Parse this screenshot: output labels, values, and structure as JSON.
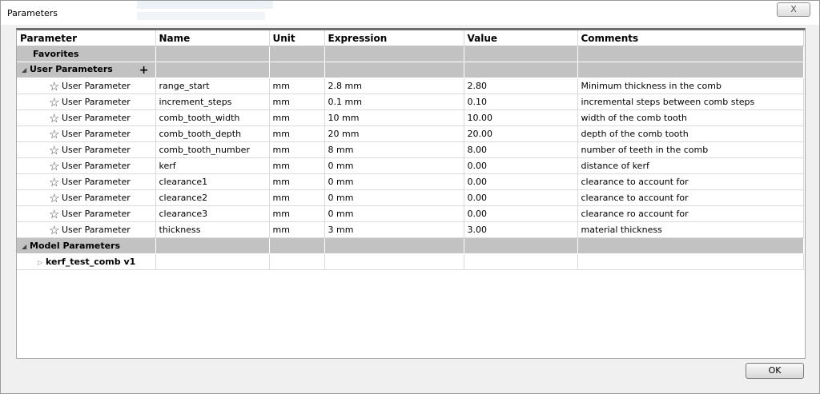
{
  "window": {
    "title": "Parameters",
    "close_label": "X",
    "ok_label": "OK"
  },
  "columns": [
    "Parameter",
    "Name",
    "Unit",
    "Expression",
    "Value",
    "Comments"
  ],
  "sections": {
    "favorites": "Favorites",
    "user_parameters": "User Parameters",
    "model_parameters": "Model Parameters",
    "add_symbol": "+"
  },
  "user_rows": [
    {
      "type": "User Parameter",
      "name": "range_start",
      "unit": "mm",
      "expression": "2.8 mm",
      "value": "2.80",
      "comment": "Minimum thickness in the comb"
    },
    {
      "type": "User Parameter",
      "name": "increment_steps",
      "unit": "mm",
      "expression": "0.1 mm",
      "value": "0.10",
      "comment": "incremental steps between comb steps"
    },
    {
      "type": "User Parameter",
      "name": "comb_tooth_width",
      "unit": "mm",
      "expression": "10 mm",
      "value": "10.00",
      "comment": "width of the comb tooth"
    },
    {
      "type": "User Parameter",
      "name": "comb_tooth_depth",
      "unit": "mm",
      "expression": "20 mm",
      "value": "20.00",
      "comment": "depth of the comb tooth"
    },
    {
      "type": "User Parameter",
      "name": "comb_tooth_number",
      "unit": "mm",
      "expression": "8 mm",
      "value": "8.00",
      "comment": "number of teeth in the comb"
    },
    {
      "type": "User Parameter",
      "name": "kerf",
      "unit": "mm",
      "expression": "0 mm",
      "value": "0.00",
      "comment": "distance of kerf"
    },
    {
      "type": "User Parameter",
      "name": "clearance1",
      "unit": "mm",
      "expression": "0 mm",
      "value": "0.00",
      "comment": "clearance to account for"
    },
    {
      "type": "User Parameter",
      "name": "clearance2",
      "unit": "mm",
      "expression": "0 mm",
      "value": "0.00",
      "comment": "clearance to account for"
    },
    {
      "type": "User Parameter",
      "name": "clearance3",
      "unit": "mm",
      "expression": "0 mm",
      "value": "0.00",
      "comment": "clearance ro account for"
    },
    {
      "type": "User Parameter",
      "name": "thickness",
      "unit": "mm",
      "expression": "3 mm",
      "value": "3.00",
      "comment": "material thickness"
    }
  ],
  "model_rows": [
    {
      "label": "kerf_test_comb v1"
    }
  ],
  "icons": {
    "favorite": "star-outline-icon",
    "expand": "triangle-expanded-icon",
    "collapsed": "triangle-collapsed-icon",
    "add": "plus-icon"
  }
}
